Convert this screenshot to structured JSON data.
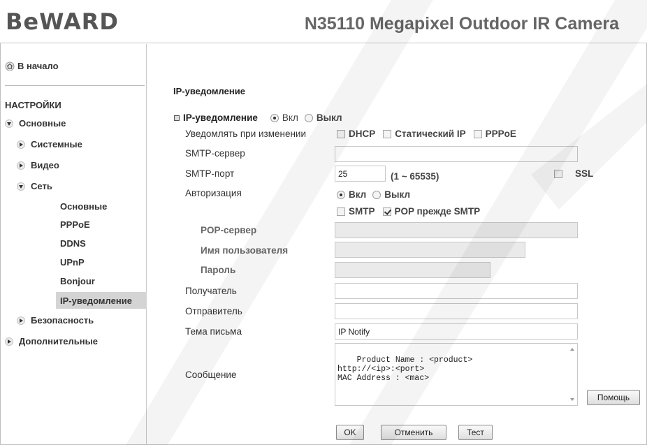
{
  "header": {
    "logo": "BeWARD",
    "model": "N35110 Megapixel Outdoor IR Camera"
  },
  "sidebar": {
    "home_label": "В начало",
    "section_heading": "НАСТРОЙКИ",
    "items": [
      {
        "label": "Основные",
        "state": "expanded"
      },
      {
        "label": "Системные",
        "state": "collapsed"
      },
      {
        "label": "Видео",
        "state": "collapsed"
      },
      {
        "label": "Сеть",
        "state": "expanded"
      },
      {
        "label": "Основные"
      },
      {
        "label": "PPPoE"
      },
      {
        "label": "DDNS"
      },
      {
        "label": "UPnP"
      },
      {
        "label": "Bonjour"
      },
      {
        "label": "IP-уведомление",
        "active": true
      },
      {
        "label": "Безопасность",
        "state": "collapsed"
      },
      {
        "label": "Дополнительные",
        "state": "collapsed"
      }
    ]
  },
  "form": {
    "title": "IP-уведомление",
    "enable": {
      "label": "IP-уведомление",
      "on_label": "Вкл",
      "off_label": "Выкл",
      "value": "on"
    },
    "notify_on_change": {
      "label": "Уведомлять при изменении",
      "options": [
        "DHCP",
        "Статический IP",
        "PPPoE"
      ],
      "checked": [
        false,
        false,
        false
      ]
    },
    "smtp_server": {
      "label": "SMTP-сервер",
      "value": ""
    },
    "smtp_port": {
      "label": "SMTP-порт",
      "value": "25",
      "range": "(1 ~ 65535)",
      "ssl_label": "SSL",
      "ssl_checked": false
    },
    "auth": {
      "label": "Авторизация",
      "on_label": "Вкл",
      "off_label": "Выкл",
      "value": "on",
      "smtp_label": "SMTP",
      "smtp_checked": false,
      "pop_label": "POP прежде SMTP",
      "pop_checked": true
    },
    "pop_server": {
      "label": "POP-сервер",
      "value": ""
    },
    "username": {
      "label": "Имя пользователя",
      "value": ""
    },
    "password": {
      "label": "Пароль",
      "value": ""
    },
    "recipient": {
      "label": "Получатель",
      "value": ""
    },
    "sender": {
      "label": "Отправитель",
      "value": ""
    },
    "subject": {
      "label": "Тема письма",
      "value": "IP Notify"
    },
    "message": {
      "label": "Сообщение",
      "value": "Product Name : <product>\nhttp://<ip>:<port>\nMAC Address : <mac>"
    },
    "help_button": "Помощь",
    "ok_button": "OK",
    "cancel_button": "Отменить",
    "test_button": "Тест"
  },
  "colors": {
    "watermark": "#f1f1f1",
    "active_nav": "#d4d4d4"
  }
}
